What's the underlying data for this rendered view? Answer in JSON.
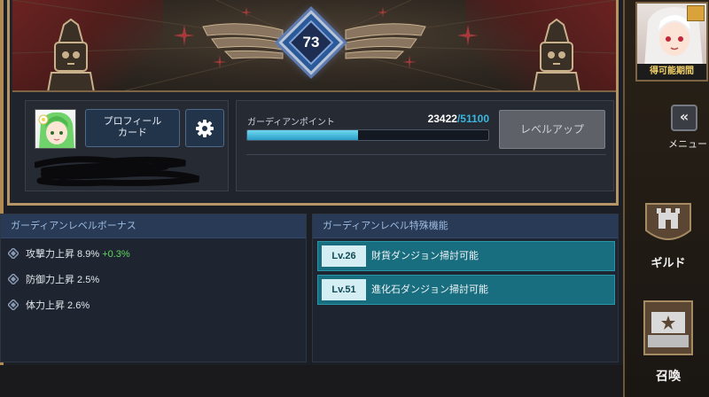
{
  "banner": {
    "level": "73",
    "level_icon": "winged-diamond-badge-icon",
    "mascot_icon": "robot-mascot-icon",
    "star_icon": "four-point-star-icon"
  },
  "profile": {
    "avatar_icon": "green-haired-character-avatar",
    "profile_card_label": "プロフィール\nカード",
    "settings_icon": "gear-icon"
  },
  "points": {
    "label": "ガーディアンポイント",
    "current": "23422",
    "separator": "/",
    "max": "51100",
    "progress_fraction": 0.458,
    "level_up_label": "レベルアップ"
  },
  "bonus": {
    "header": "ガーディアンレベルボーナス",
    "rows": [
      {
        "label": "攻撃力上昇 8.9%",
        "plus": "+0.3%"
      },
      {
        "label": "防御力上昇 2.5%",
        "plus": ""
      },
      {
        "label": "体力上昇 2.6%",
        "plus": ""
      }
    ]
  },
  "features": {
    "header": "ガーディアンレベル特殊機能",
    "rows": [
      {
        "level": "Lv.26",
        "label": "財貨ダンジョン掃討可能"
      },
      {
        "level": "Lv.51",
        "label": "進化石ダンジョン掃討可能"
      }
    ]
  },
  "sidebar": {
    "event_label": "得可能期間",
    "menu_icon": "double-chevron-left-icon",
    "menu_label": "メニュー",
    "guild_icon": "castle-shield-icon",
    "guild_label": "ギルド",
    "summon_icon": "star-chest-icon",
    "summon_label": "召喚"
  },
  "colors": {
    "accent_cyan": "#3ab7e0",
    "bonus_green": "#5fd55f",
    "feature_teal": "#186d7f",
    "frame_gold": "#b59465"
  }
}
